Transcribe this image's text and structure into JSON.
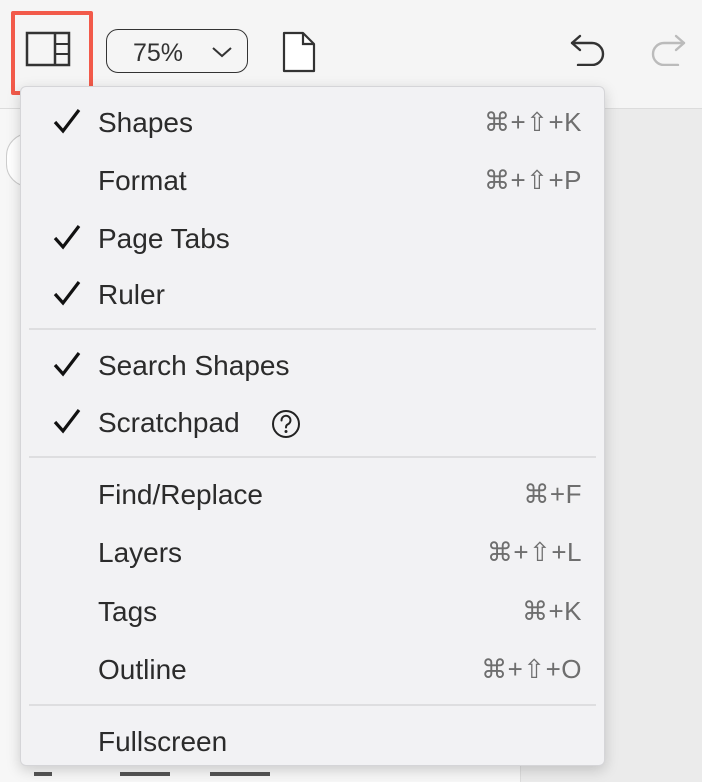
{
  "toolbar": {
    "zoom_value": "75%"
  },
  "menu": {
    "items": [
      {
        "label": "Shapes",
        "shortcut": "⌘+⇧+K",
        "checked": true
      },
      {
        "label": "Format",
        "shortcut": "⌘+⇧+P",
        "checked": false
      },
      {
        "label": "Page Tabs",
        "shortcut": "",
        "checked": true
      },
      {
        "label": "Ruler",
        "shortcut": "",
        "checked": true
      },
      {
        "label": "Search Shapes",
        "shortcut": "",
        "checked": true
      },
      {
        "label": "Scratchpad",
        "shortcut": "",
        "checked": true
      },
      {
        "label": "Find/Replace",
        "shortcut": "⌘+F",
        "checked": false
      },
      {
        "label": "Layers",
        "shortcut": "⌘+⇧+L",
        "checked": false
      },
      {
        "label": "Tags",
        "shortcut": "⌘+K",
        "checked": false
      },
      {
        "label": "Outline",
        "shortcut": "⌘+⇧+O",
        "checked": false
      },
      {
        "label": "Fullscreen",
        "shortcut": "",
        "checked": false
      }
    ]
  },
  "icons": {
    "panel_toggle": "panel-layout-icon",
    "zoom_dropdown": "chevron-down-icon",
    "page": "page-icon",
    "undo": "undo-icon",
    "redo": "redo-icon",
    "check": "checkmark-icon",
    "help": "help-circle-icon"
  },
  "colors": {
    "highlight_border": "#f25a4a",
    "menu_background": "#f2f2f4"
  }
}
